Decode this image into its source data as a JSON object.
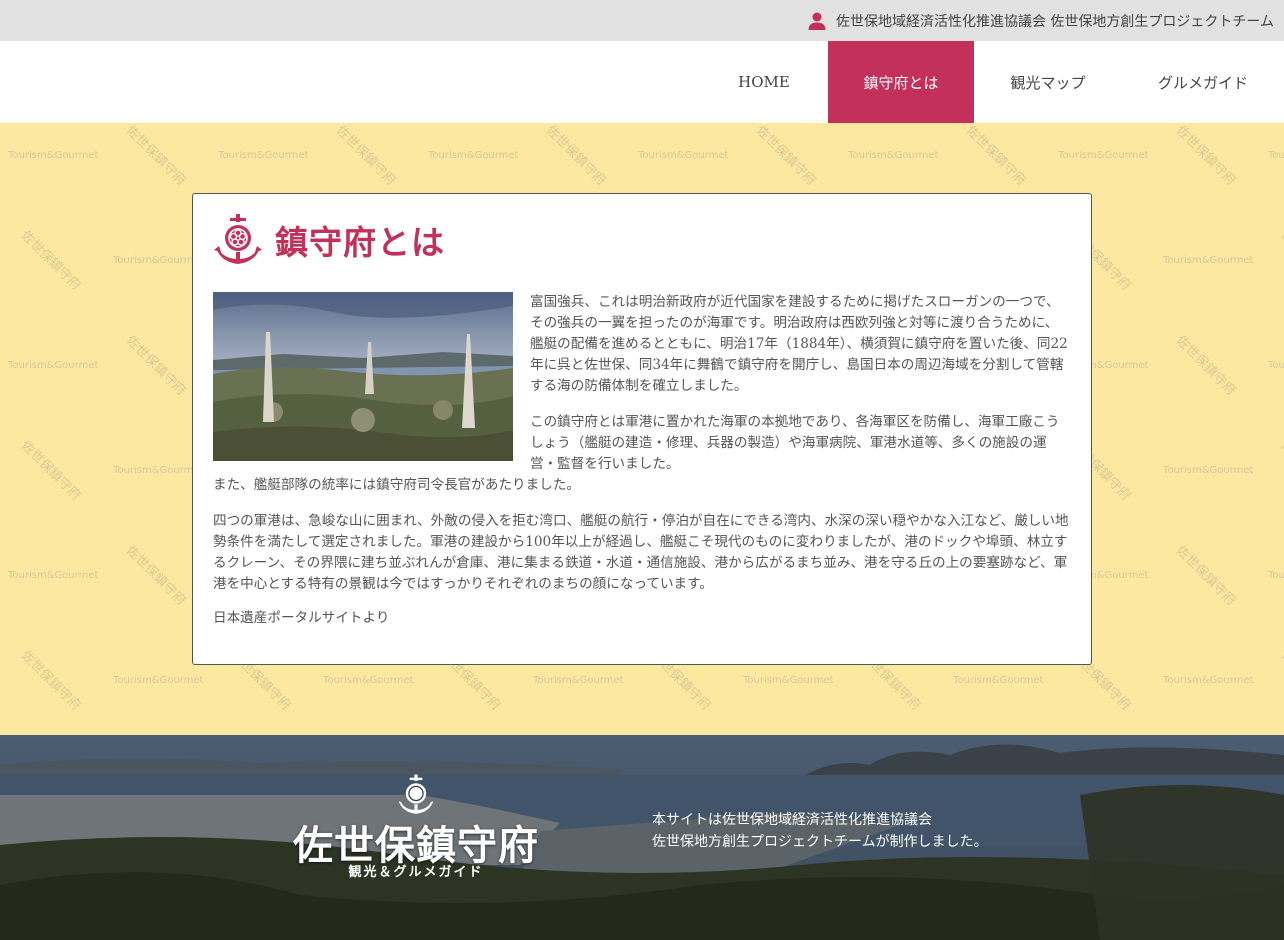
{
  "topbar": {
    "organization": "佐世保地域経済活性化推進協議会 佐世保地方創生プロジェクトチーム",
    "icon": "user-icon"
  },
  "nav": {
    "items": [
      {
        "label": "HOME",
        "active": false
      },
      {
        "label": "鎮守府とは",
        "active": true
      },
      {
        "label": "観光マップ",
        "active": false
      },
      {
        "label": "グルメガイド",
        "active": false
      }
    ]
  },
  "watermark": {
    "text_en": "Tourism&Gourmet",
    "text_jp": "佐世保鎮守府"
  },
  "content": {
    "icon": "anchor-emblem-icon",
    "title": "鎮守府とは",
    "paragraphs": [
      "富国強兵、これは明治新政府が近代国家を建設するために掲げたスローガンの一つで、その強兵の一翼を担ったのが海軍です。明治政府は西欧列強と対等に渡り合うために、艦艇の配備を進めるとともに、明治17年（1884年）、横須賀に鎮守府を置いた後、同22年に呉と佐世保、同34年に舞鶴で鎮守府を開庁し、島国日本の周辺海域を分割して管轄する海の防備体制を確立しました。",
      "この鎮守府とは軍港に置かれた海軍の本拠地であり、各海軍区を防備し、海軍工廠こうしょう（艦艇の建造・修理、兵器の製造）や海軍病院、軍港水道等、多くの施設の運営・監督を行いました。",
      "また、艦艇部隊の統率には鎮守府司令長官があたりました。",
      "四つの軍港は、急峻な山に囲まれ、外敵の侵入を拒む湾口、艦艇の航行・停泊が自在にできる湾内、水深の深い穏やかな入江など、厳しい地勢条件を満たして選定されました。軍港の建設から100年以上が経過し、艦艇こそ現代のものに変わりましたが、港のドックや埠頭、林立するクレーン、その界隈に建ち並ぶれんが倉庫、港に集まる鉄道・水道・通信施設、港から広がるまち並み、港を守る丘の上の要塞跡など、軍港を中心とする特有の景観は今ではすっかりそれぞれのまちの顔になっています。",
      "日本遺産ポータルサイトより"
    ]
  },
  "footer": {
    "logo_main": "佐世保鎮守府",
    "logo_sub": "観光＆グルメガイド",
    "credit_line1": "本サイトは佐世保地域経済活性化推進協議会",
    "credit_line2": "佐世保地方創生プロジェクトチームが制作しました。"
  },
  "colors": {
    "accent": "#c2305b",
    "pattern_bg": "#fde8a1",
    "topbar_bg": "#e2e2e2"
  }
}
